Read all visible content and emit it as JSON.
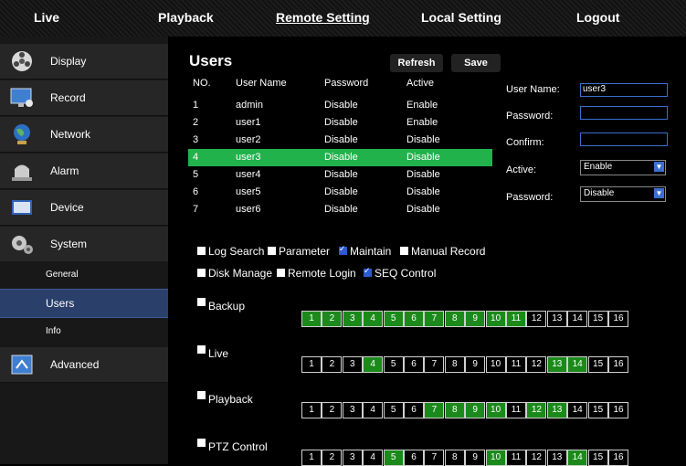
{
  "topnav": [
    "Live",
    "Playback",
    "Remote Setting",
    "Local Setting",
    "Logout"
  ],
  "sidebar": {
    "items": [
      {
        "label": "Display",
        "icon": "film-reel-icon"
      },
      {
        "label": "Record",
        "icon": "monitor-icon"
      },
      {
        "label": "Network",
        "icon": "globe-icon"
      },
      {
        "label": "Alarm",
        "icon": "siren-icon"
      },
      {
        "label": "Device",
        "icon": "hard-drive-icon"
      },
      {
        "label": "System",
        "icon": "gears-icon"
      }
    ],
    "system_sub": [
      "General",
      "Users",
      "Info"
    ],
    "advanced": {
      "label": "Advanced",
      "icon": "advanced-icon"
    }
  },
  "users": {
    "title": "Users",
    "refresh_label": "Refresh",
    "save_label": "Save",
    "columns": [
      "NO.",
      "User Name",
      "Password",
      "Active"
    ],
    "rows": [
      [
        "1",
        "admin",
        "Disable",
        "Enable"
      ],
      [
        "2",
        "user1",
        "Disable",
        "Enable"
      ],
      [
        "3",
        "user2",
        "Disable",
        "Disable"
      ],
      [
        "4",
        "user3",
        "Disable",
        "Disable"
      ],
      [
        "5",
        "user4",
        "Disable",
        "Disable"
      ],
      [
        "6",
        "user5",
        "Disable",
        "Disable"
      ],
      [
        "7",
        "user6",
        "Disable",
        "Disable"
      ]
    ],
    "selected_row": 3
  },
  "form": {
    "username_label": "User Name:",
    "username_value": "user3",
    "password_label": "Password:",
    "password_value": "",
    "confirm_label": "Confirm:",
    "confirm_value": "",
    "active_label": "Active:",
    "active_value": "Enable",
    "password_mode_label": "Password:",
    "password_mode_value": "Disable"
  },
  "permissions": [
    {
      "label": "Log Search",
      "checked": false
    },
    {
      "label": "Parameter",
      "checked": false
    },
    {
      "label": "Maintain",
      "checked": true
    },
    {
      "label": "Manual Record",
      "checked": false
    },
    {
      "label": "Disk Manage",
      "checked": false
    },
    {
      "label": "Remote Login",
      "checked": false
    },
    {
      "label": "SEQ Control",
      "checked": true
    }
  ],
  "channel_groups": [
    {
      "label": "Backup",
      "checked": false,
      "enabled": [
        1,
        2,
        3,
        4,
        5,
        6,
        7,
        8,
        9,
        10,
        11
      ]
    },
    {
      "label": "Live",
      "checked": false,
      "enabled": [
        4,
        13,
        14
      ]
    },
    {
      "label": "Playback",
      "checked": false,
      "enabled": [
        7,
        8,
        9,
        10,
        12,
        13
      ]
    },
    {
      "label": "PTZ Control",
      "checked": false,
      "enabled": [
        5,
        10,
        14
      ]
    }
  ],
  "channels": [
    "1",
    "2",
    "3",
    "4",
    "5",
    "6",
    "7",
    "8",
    "9",
    "10",
    "11",
    "12",
    "13",
    "14",
    "15",
    "16"
  ],
  "colors": {
    "selected_row": "#22b24c",
    "channel_on": "#1b8a1b",
    "sidebar_selected": "#2a3f6a"
  }
}
